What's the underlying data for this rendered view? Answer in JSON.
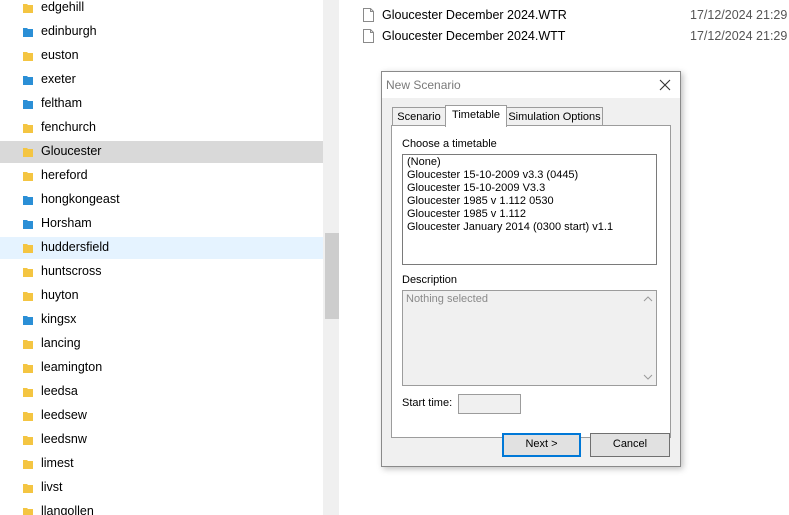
{
  "folders": [
    {
      "label": "edgehill",
      "color": "#f4c542"
    },
    {
      "label": "edinburgh",
      "color": "#2b8fd6"
    },
    {
      "label": "euston",
      "color": "#f4c542"
    },
    {
      "label": "exeter",
      "color": "#2b8fd6"
    },
    {
      "label": "feltham",
      "color": "#2b8fd6"
    },
    {
      "label": "fenchurch",
      "color": "#f4c542"
    },
    {
      "label": "Gloucester",
      "color": "#f4c542",
      "state": "selected"
    },
    {
      "label": "hereford",
      "color": "#f4c542"
    },
    {
      "label": "hongkongeast",
      "color": "#2b8fd6"
    },
    {
      "label": "Horsham",
      "color": "#2b8fd6"
    },
    {
      "label": "huddersfield",
      "color": "#f4c542",
      "state": "hovered"
    },
    {
      "label": "huntscross",
      "color": "#f4c542"
    },
    {
      "label": "huyton",
      "color": "#f4c542"
    },
    {
      "label": "kingsx",
      "color": "#2b8fd6"
    },
    {
      "label": "lancing",
      "color": "#f4c542"
    },
    {
      "label": "leamington",
      "color": "#f4c542"
    },
    {
      "label": "leedsa",
      "color": "#f4c542"
    },
    {
      "label": "leedsew",
      "color": "#f4c542"
    },
    {
      "label": "leedsnw",
      "color": "#f4c542"
    },
    {
      "label": "limest",
      "color": "#f4c542"
    },
    {
      "label": "livst",
      "color": "#f4c542"
    },
    {
      "label": "llangollen",
      "color": "#f4c542"
    }
  ],
  "files": [
    {
      "name": "Gloucester December 2024.WTR",
      "date": "17/12/2024 21:29"
    },
    {
      "name": "Gloucester December 2024.WTT",
      "date": "17/12/2024 21:29"
    }
  ],
  "dialog": {
    "title": "New Scenario",
    "tabs": [
      {
        "label": "Scenario"
      },
      {
        "label": "Timetable"
      },
      {
        "label": "Simulation Options"
      }
    ],
    "choose_label": "Choose a timetable",
    "timetables": [
      "(None)",
      "Gloucester 15-10-2009 v3.3 (0445)",
      "Gloucester 15-10-2009 V3.3",
      "Gloucester 1985 v 1.112 0530",
      "Gloucester 1985 v 1.112",
      "Gloucester January 2014 (0300 start) v1.1"
    ],
    "description_label": "Description",
    "description_text": "Nothing selected",
    "start_time_label": "Start time:",
    "start_time_value": "",
    "next_label": "Next >",
    "cancel_label": "Cancel"
  }
}
